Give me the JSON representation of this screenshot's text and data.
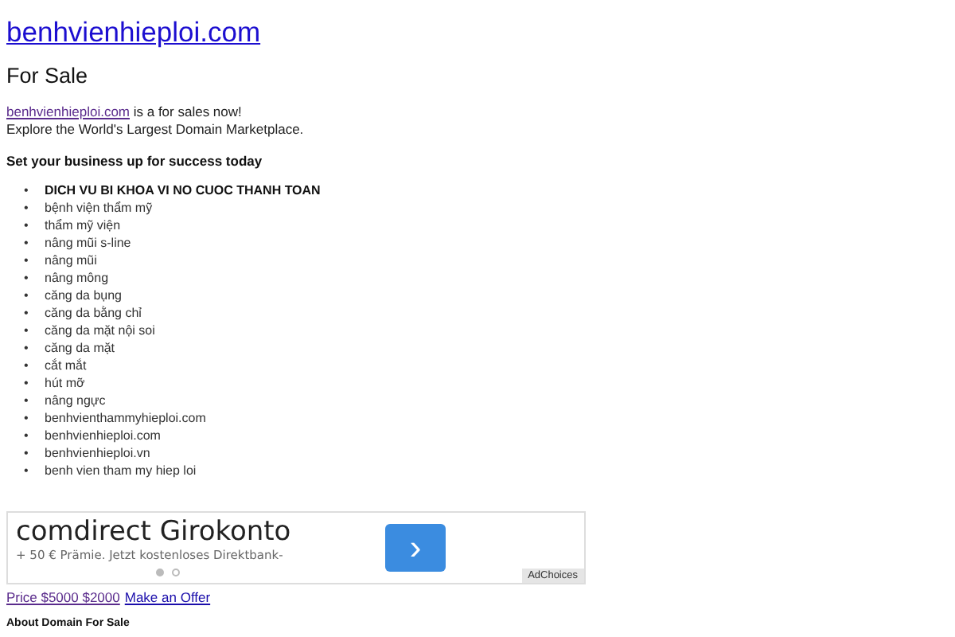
{
  "header": {
    "domain_link": "benhvienhieploi.com",
    "heading": "For Sale"
  },
  "intro": {
    "domain_link": "benhvienhieploi.com",
    "text": " is a for sales now!",
    "line_2": "Explore the World's Largest Domain Marketplace."
  },
  "tagline": "Set your business up for success today",
  "bullet": "•",
  "keywords": [
    {
      "text": "DICH VU BI KHOA VI NO CUOC THANH TOAN",
      "bold": true
    },
    {
      "text": "bệnh viện thẩm mỹ",
      "bold": false
    },
    {
      "text": "thẩm mỹ viện",
      "bold": false
    },
    {
      "text": "nâng mũi s-line",
      "bold": false
    },
    {
      "text": "nâng mũi",
      "bold": false
    },
    {
      "text": "nâng mông",
      "bold": false
    },
    {
      "text": "căng da bụng",
      "bold": false
    },
    {
      "text": "căng da bằng chỉ",
      "bold": false
    },
    {
      "text": "căng da mặt nội soi",
      "bold": false
    },
    {
      "text": "căng da mặt",
      "bold": false
    },
    {
      "text": "cắt mắt",
      "bold": false
    },
    {
      "text": "hút mỡ",
      "bold": false
    },
    {
      "text": "nâng ngực",
      "bold": false
    },
    {
      "text": "benhvienthammyhieploi.com",
      "bold": false
    },
    {
      "text": "benhvienhieploi.com",
      "bold": false
    },
    {
      "text": "benhvienhieploi.vn",
      "bold": false
    },
    {
      "text": "benh vien tham my hiep loi",
      "bold": false
    }
  ],
  "ad": {
    "title": "comdirect Girokonto",
    "description": "+ 50 € Prämie. Jetzt kostenloses Direktbank-",
    "next_button": "›",
    "dots": [
      {
        "selected": true
      },
      {
        "selected": false
      }
    ],
    "adchoices": "AdChoices"
  },
  "price_link": "Price $5000 $2000",
  "offer_link": "Make an Offer",
  "footer_heading": "About Domain For Sale"
}
